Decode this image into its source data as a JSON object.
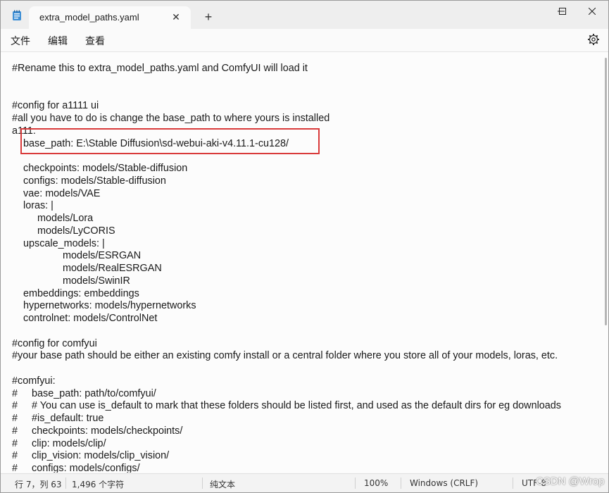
{
  "tab": {
    "title": "extra_model_paths.yaml",
    "close": "✕",
    "new_tab": "+"
  },
  "menu": {
    "file": "文件",
    "edit": "编辑",
    "view": "查看"
  },
  "editor": {
    "lines": [
      "#Rename this to extra_model_paths.yaml and ComfyUI will load it",
      "",
      "",
      "#config for a1111 ui",
      "#all you have to do is change the base_path to where yours is installed",
      "a111:",
      "    base_path: E:\\Stable Diffusion\\sd-webui-aki-v4.11.1-cu128/",
      "",
      "    checkpoints: models/Stable-diffusion",
      "    configs: models/Stable-diffusion",
      "    vae: models/VAE",
      "    loras: |",
      "         models/Lora",
      "         models/LyCORIS",
      "    upscale_models: |",
      "                  models/ESRGAN",
      "                  models/RealESRGAN",
      "                  models/SwinIR",
      "    embeddings: embeddings",
      "    hypernetworks: models/hypernetworks",
      "    controlnet: models/ControlNet",
      "",
      "#config for comfyui",
      "#your base path should be either an existing comfy install or a central folder where you store all of your models, loras, etc.",
      "",
      "#comfyui:",
      "#     base_path: path/to/comfyui/",
      "#     # You can use is_default to mark that these folders should be listed first, and used as the default dirs for eg downloads",
      "#     #is_default: true",
      "#     checkpoints: models/checkpoints/",
      "#     clip: models/clip/",
      "#     clip_vision: models/clip_vision/",
      "#     configs: models/configs/"
    ]
  },
  "status": {
    "position": "行 7，列 63",
    "char_count": "1,496 个字符",
    "format": "纯文本",
    "zoom": "100%",
    "line_ending": "Windows (CRLF)",
    "encoding": "UTF-8"
  },
  "watermark": "CSDN @Wrop",
  "colors": {
    "highlight_border": "#d93a3a"
  }
}
